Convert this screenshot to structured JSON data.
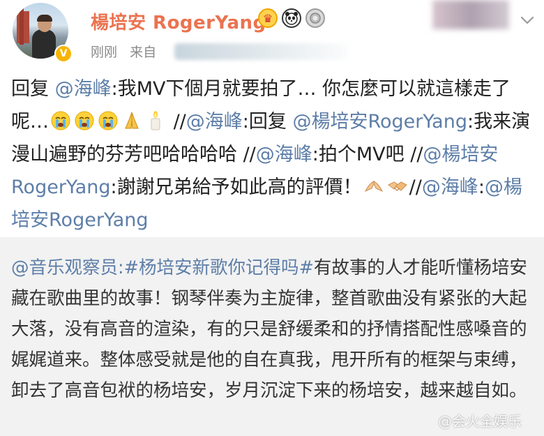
{
  "post": {
    "username": "楊培安 RogerYang",
    "time": "刚刚",
    "source_prefix": "来自",
    "badges": [
      "crown-icon",
      "panda-icon",
      "medal-icon"
    ],
    "text_segments": [
      {
        "type": "text",
        "value": "回复 "
      },
      {
        "type": "mention",
        "value": "@海峰"
      },
      {
        "type": "text",
        "value": ":我MV下個月就要拍了… 你怎麼可以就這樣走了呢…"
      },
      {
        "type": "emoji",
        "value": "cry-face-icon"
      },
      {
        "type": "emoji",
        "value": "cry-face-icon"
      },
      {
        "type": "emoji",
        "value": "cry-face-icon"
      },
      {
        "type": "emoji",
        "value": "praying-hands-icon"
      },
      {
        "type": "emoji",
        "value": "candle-icon"
      },
      {
        "type": "text",
        "value": " //"
      },
      {
        "type": "mention",
        "value": "@海峰"
      },
      {
        "type": "text",
        "value": ":回复 "
      },
      {
        "type": "mention",
        "value": "@楊培安RogerYang"
      },
      {
        "type": "text",
        "value": ":我来演漫山遍野的芬芳吧哈哈哈哈 //"
      },
      {
        "type": "mention",
        "value": "@海峰"
      },
      {
        "type": "text",
        "value": ":拍个MV吧 //"
      },
      {
        "type": "mention",
        "value": "@楊培安RogerYang"
      },
      {
        "type": "text",
        "value": ":謝謝兄弟給予如此高的評價！"
      },
      {
        "type": "emoji",
        "value": "bow-hands-icon"
      },
      {
        "type": "emoji",
        "value": "handshake-icon"
      },
      {
        "type": "text",
        "value": "//"
      },
      {
        "type": "mention",
        "value": "@海峰"
      },
      {
        "type": "text",
        "value": ":"
      },
      {
        "type": "mention",
        "value": "@楊培安RogerYang"
      }
    ]
  },
  "quote": {
    "mention": "@音乐观察员",
    "hashtag": ":#杨培安新歌你记得吗#",
    "body": "有故事的人才能听懂杨培安藏在歌曲里的故事！钢琴伴奏为主旋律，整首歌曲没有紧张的大起大落，没有高音的渲染，有的只是舒缓柔和的抒情搭配性感嗓音的娓娓道来。整体感受就是他的自在真我，甩开所有的框架与束缚，卸去了高音包袱的杨培安，岁月沉淀下来的杨培安，越来越自如。"
  },
  "watermark": "@会火全娱乐",
  "colors": {
    "username": "#eb7350",
    "link": "#5d7ea8",
    "quote_bg": "#f2f2f2",
    "vip_badge": "#f7b500"
  }
}
